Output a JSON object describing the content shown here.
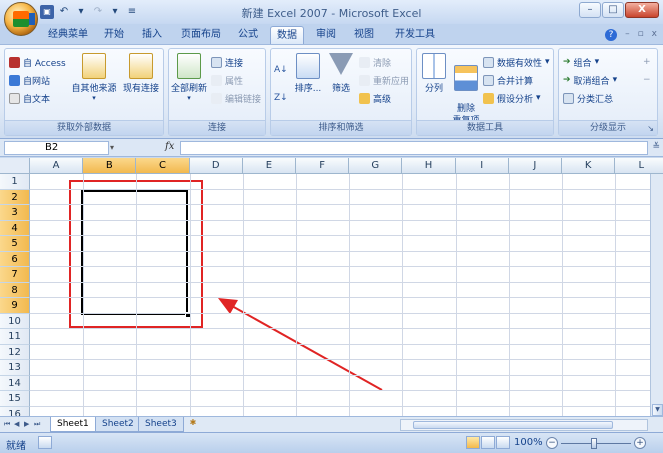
{
  "window": {
    "title": "新建 Excel 2007 - Microsoft Excel",
    "controls": [
      "–",
      "□",
      "X"
    ]
  },
  "tabs": [
    {
      "label": "经典菜单"
    },
    {
      "label": "开始"
    },
    {
      "label": "插入"
    },
    {
      "label": "页面布局"
    },
    {
      "label": "公式"
    },
    {
      "label": "数据"
    },
    {
      "label": "审阅"
    },
    {
      "label": "视图"
    },
    {
      "label": "开发工具"
    }
  ],
  "active_tab": "数据",
  "ribbon": {
    "groups": {
      "external_data": {
        "label": "获取外部数据",
        "from_access": "自 Access",
        "from_web": "自网站",
        "from_text": "自文本",
        "from_other": "自其他来源",
        "existing_connections": "现有连接"
      },
      "connections": {
        "label": "连接",
        "refresh_all": "全部刷新",
        "connections": "连接",
        "properties": "属性",
        "edit_links": "编辑链接"
      },
      "sort_filter": {
        "label": "排序和筛选",
        "sort": "排序...",
        "filter": "筛选",
        "clear": "清除",
        "reapply": "重新应用",
        "advanced": "高级"
      },
      "data_tools": {
        "label": "数据工具",
        "text_to_columns": "分列",
        "remove_duplicates": "删除\n重复项",
        "data_validation": "数据有效性",
        "consolidate": "合并计算",
        "what_if": "假设分析"
      },
      "outline": {
        "label": "分级显示",
        "group": "组合",
        "ungroup": "取消组合",
        "subtotal": "分类汇总"
      }
    }
  },
  "formula_bar": {
    "name_box": "B2",
    "fx": "fx",
    "formula": ""
  },
  "grid": {
    "columns": [
      "A",
      "B",
      "C",
      "D",
      "E",
      "F",
      "G",
      "H",
      "I",
      "J",
      "K",
      "L"
    ],
    "rows": [
      "1",
      "2",
      "3",
      "4",
      "5",
      "6",
      "7",
      "8",
      "9",
      "10",
      "11",
      "12",
      "13",
      "14",
      "15",
      "16"
    ],
    "selected_range": "B2:C9"
  },
  "sheets": [
    {
      "label": "Sheet1"
    },
    {
      "label": "Sheet2"
    },
    {
      "label": "Sheet3"
    }
  ],
  "status": {
    "ready": "就绪",
    "zoom": "100%"
  },
  "colors": {
    "annotation": "#e02424",
    "selected_header": "#f2b94f",
    "accent": "#15428b"
  }
}
